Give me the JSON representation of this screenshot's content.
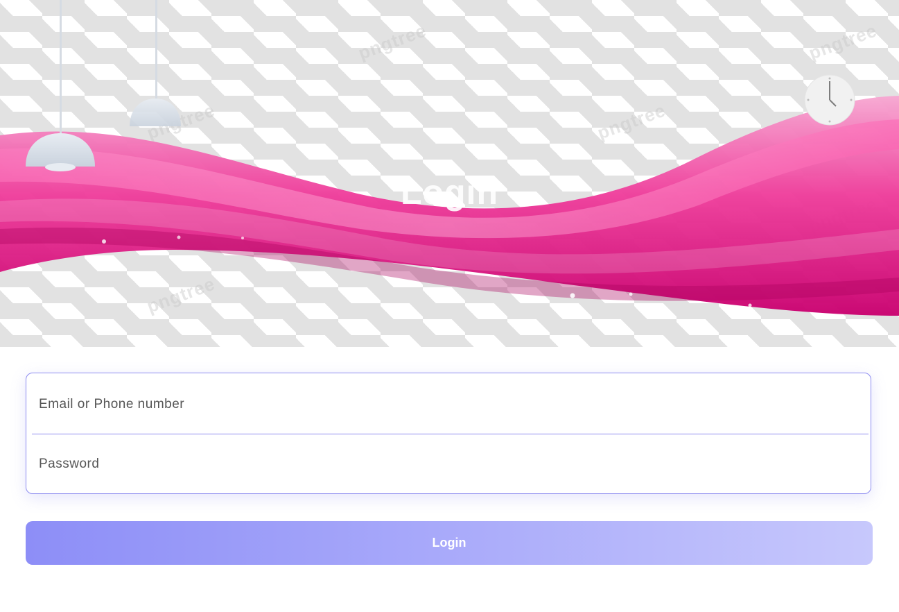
{
  "hero": {
    "title": "Login",
    "watermark": "pngtree"
  },
  "form": {
    "email_placeholder": "Email or Phone number",
    "password_placeholder": "Password"
  },
  "actions": {
    "login_label": "Login"
  },
  "colors": {
    "accent": "#8d8cf0",
    "wave": "#ee3c9a",
    "button_start": "#8d8ef7",
    "button_end": "#c7c8fc"
  },
  "icons": [
    "pendant-lamp-icon",
    "clock-icon"
  ]
}
